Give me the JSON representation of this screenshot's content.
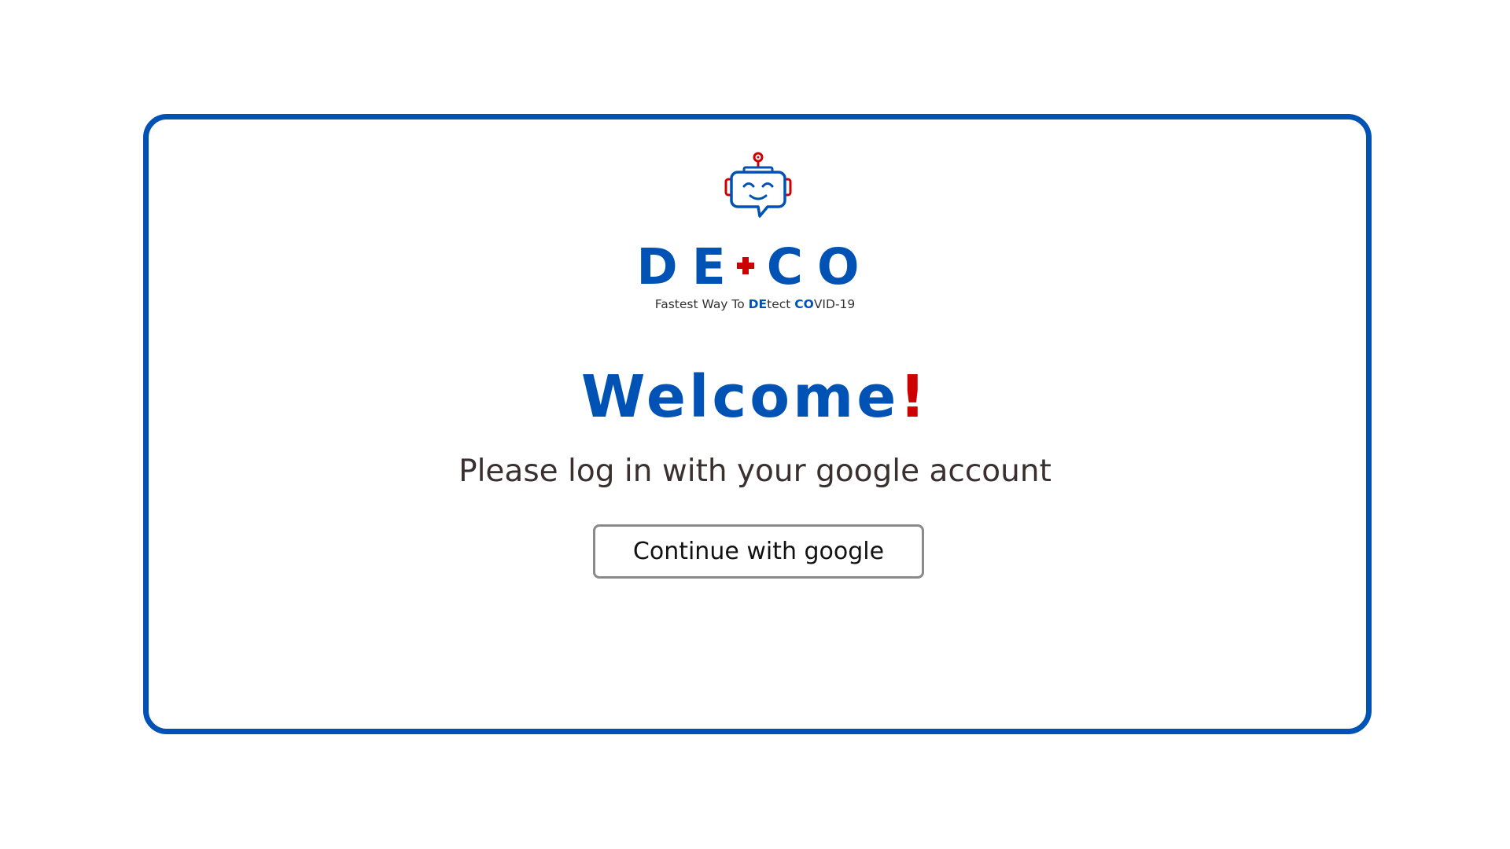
{
  "brand": {
    "logo_icon": "robot-chat-icon",
    "name_left": "DE",
    "name_right": "CO",
    "cross_icon": "medical-cross-icon",
    "tagline_part1": "Fastest Way To ",
    "tagline_hl1": "DE",
    "tagline_part2": "tect ",
    "tagline_hl2": "CO",
    "tagline_part3": "VID-19"
  },
  "main": {
    "welcome_text": "Welcome",
    "welcome_mark": "!",
    "subtitle": "Please log in with your google account",
    "google_button_label": "Continue with google"
  },
  "colors": {
    "primary": "#0052b4",
    "accent": "#cc0000",
    "text": "#3a3030",
    "button_border": "#8a8a8a"
  }
}
